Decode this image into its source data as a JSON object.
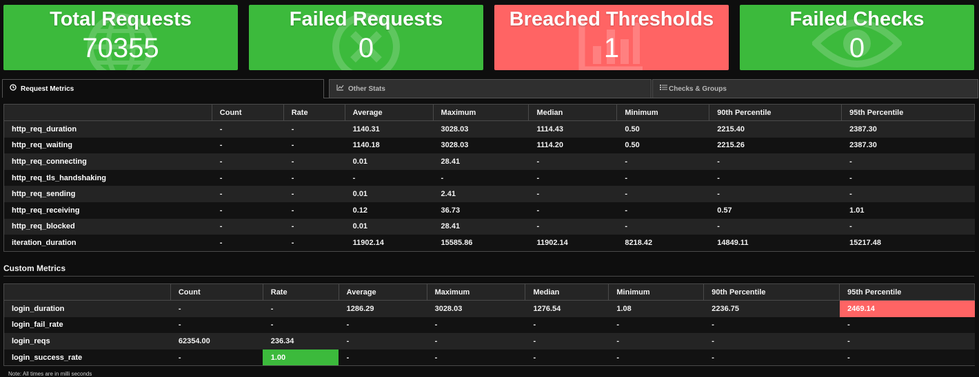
{
  "cards": [
    {
      "title": "Total Requests",
      "value": "70355",
      "status": "ok",
      "icon": "globe-icon"
    },
    {
      "title": "Failed Requests",
      "value": "0",
      "status": "ok",
      "icon": "x-circle-icon"
    },
    {
      "title": "Breached Thresholds",
      "value": "1",
      "status": "bad",
      "icon": "bar-chart-icon"
    },
    {
      "title": "Failed Checks",
      "value": "0",
      "status": "ok",
      "icon": "eye-icon"
    }
  ],
  "tabs": [
    {
      "label": "Request Metrics",
      "icon": "clock-icon",
      "active": true
    },
    {
      "label": "Other Stats",
      "icon": "line-chart-icon",
      "active": false
    },
    {
      "label": "Checks & Groups",
      "icon": "list-icon",
      "active": false
    }
  ],
  "request_metrics": {
    "columns": [
      "",
      "Count",
      "Rate",
      "Average",
      "Maximum",
      "Median",
      "Minimum",
      "90th Percentile",
      "95th Percentile"
    ],
    "rows": [
      [
        "http_req_duration",
        "-",
        "-",
        "1140.31",
        "3028.03",
        "1114.43",
        "0.50",
        "2215.40",
        "2387.30"
      ],
      [
        "http_req_waiting",
        "-",
        "-",
        "1140.18",
        "3028.03",
        "1114.20",
        "0.50",
        "2215.26",
        "2387.30"
      ],
      [
        "http_req_connecting",
        "-",
        "-",
        "0.01",
        "28.41",
        "-",
        "-",
        "-",
        "-"
      ],
      [
        "http_req_tls_handshaking",
        "-",
        "-",
        "-",
        "-",
        "-",
        "-",
        "-",
        "-"
      ],
      [
        "http_req_sending",
        "-",
        "-",
        "0.01",
        "2.41",
        "-",
        "-",
        "-",
        "-"
      ],
      [
        "http_req_receiving",
        "-",
        "-",
        "0.12",
        "36.73",
        "-",
        "-",
        "0.57",
        "1.01"
      ],
      [
        "http_req_blocked",
        "-",
        "-",
        "0.01",
        "28.41",
        "-",
        "-",
        "-",
        "-"
      ],
      [
        "iteration_duration",
        "-",
        "-",
        "11902.14",
        "15585.86",
        "11902.14",
        "8218.42",
        "14849.11",
        "15217.48"
      ]
    ]
  },
  "custom_metrics": {
    "title": "Custom Metrics",
    "columns": [
      "",
      "Count",
      "Rate",
      "Average",
      "Maximum",
      "Median",
      "Minimum",
      "90th Percentile",
      "95th Percentile"
    ],
    "rows": [
      [
        "login_duration",
        "-",
        "-",
        "1286.29",
        "3028.03",
        "1276.54",
        "1.08",
        "2236.75",
        "2469.14"
      ],
      [
        "login_fail_rate",
        "-",
        "-",
        "-",
        "-",
        "-",
        "-",
        "-",
        "-"
      ],
      [
        "login_reqs",
        "62354.00",
        "236.34",
        "-",
        "-",
        "-",
        "-",
        "-",
        "-"
      ],
      [
        "login_success_rate",
        "-",
        "1.00",
        "-",
        "-",
        "-",
        "-",
        "-",
        "-"
      ]
    ],
    "highlights": [
      {
        "row": 0,
        "col": 8,
        "color": "#ff6464"
      },
      {
        "row": 3,
        "col": 2,
        "color": "#3cba3c"
      }
    ]
  },
  "note": "Note: All times are in milli seconds",
  "colors": {
    "ok": "#3cba3c",
    "bad": "#ff6464",
    "background": "#0e0e0e"
  }
}
